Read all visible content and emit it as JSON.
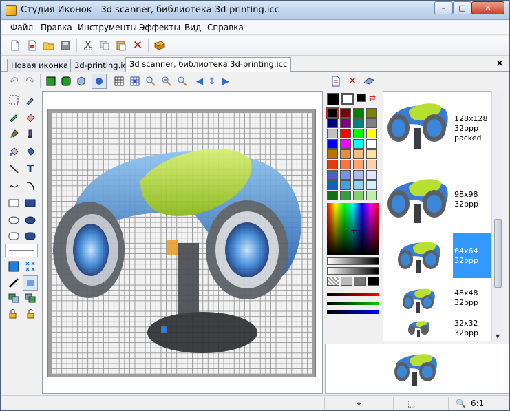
{
  "window": {
    "title": "Студия Иконок - 3d scanner, библиотека 3d-printing.icc",
    "min": "–",
    "max": "□",
    "close": "✕"
  },
  "menu": [
    "Файл",
    "Правка",
    "Инструменты",
    "Эффекты",
    "Вид",
    "Справка"
  ],
  "tabs": [
    {
      "label": "Новая иконка 1",
      "active": false
    },
    {
      "label": "3d-printing.icc",
      "active": false
    },
    {
      "label": "3d scanner, библиотека 3d-printing.icc",
      "active": true
    }
  ],
  "tab_close": "×",
  "palette": {
    "colors": [
      "#000000",
      "#800000",
      "#008000",
      "#808000",
      "#000080",
      "#800080",
      "#008080",
      "#808080",
      "#c0c0c0",
      "#ff0000",
      "#00ff00",
      "#ffff00",
      "#0000ff",
      "#ff00ff",
      "#00ffff",
      "#ffffff",
      "#c07000",
      "#e09040",
      "#f0c080",
      "#ffe0a0",
      "#e04010",
      "#ff7040",
      "#ffa070",
      "#ffd0b0",
      "#5060c0",
      "#8090e0",
      "#b0b8f0",
      "#dfe4ff",
      "#1060c0",
      "#40a0e0",
      "#90d0f0",
      "#d0f0ff",
      "#107010",
      "#30a040",
      "#80d070",
      "#c0f0b0"
    ]
  },
  "sizes": [
    {
      "label": "128x128\n32bpp\npacked",
      "selected": false
    },
    {
      "label": "98x98\n32bpp",
      "selected": false
    },
    {
      "label": "64x64\n32bpp",
      "selected": true
    },
    {
      "label": "48x48\n32bpp",
      "selected": false
    },
    {
      "label": "32x32\n32bpp",
      "selected": false
    }
  ],
  "status": {
    "zoom": "6:1"
  },
  "colors": {
    "selection": "#3399ff",
    "accent_green": "#a4d41e",
    "accent_blue": "#2f7ad0"
  }
}
